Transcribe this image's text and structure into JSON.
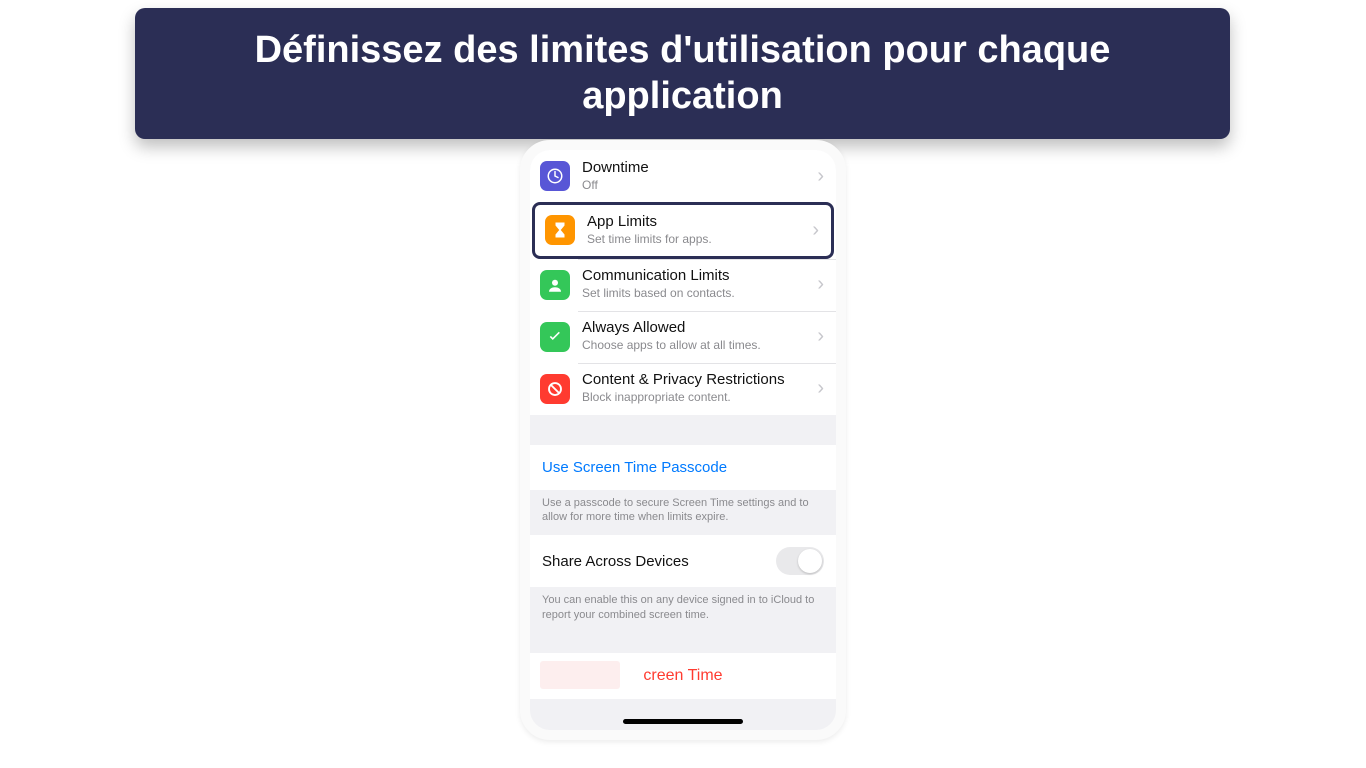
{
  "banner": {
    "text": "Définissez des limites d'utilisation pour chaque application"
  },
  "colors": {
    "downtime": "#5856d6",
    "applimits": "#ff9500",
    "communication": "#34c759",
    "always": "#34c759",
    "content": "#ff3b30"
  },
  "rows": {
    "downtime": {
      "title": "Downtime",
      "sub": "Off"
    },
    "applimits": {
      "title": "App Limits",
      "sub": "Set time limits for apps."
    },
    "communication": {
      "title": "Communication Limits",
      "sub": "Set limits based on contacts."
    },
    "always": {
      "title": "Always Allowed",
      "sub": "Choose apps to allow at all times."
    },
    "content": {
      "title": "Content & Privacy Restrictions",
      "sub": "Block inappropriate content."
    }
  },
  "passcode": {
    "link": "Use Screen Time Passcode",
    "hint": "Use a passcode to secure Screen Time settings and to allow for more time when limits expire."
  },
  "share": {
    "label": "Share Across Devices",
    "hint": "You can enable this on any device signed in to iCloud to report your combined screen time."
  },
  "turnoff": {
    "label_visible": "creen Time"
  }
}
